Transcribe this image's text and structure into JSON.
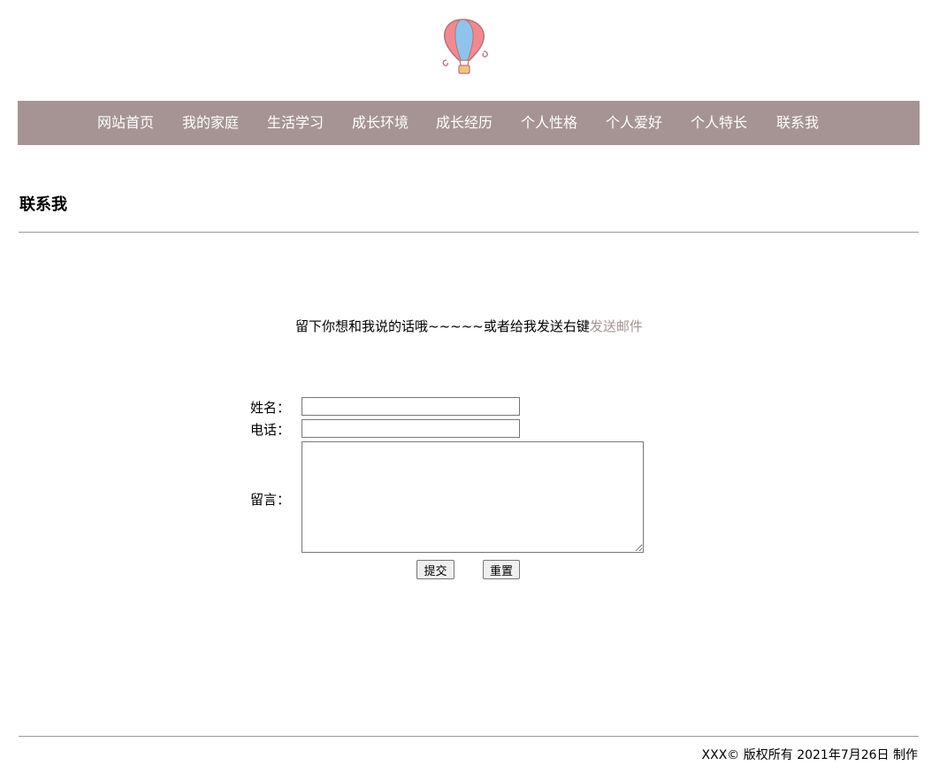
{
  "logo": {
    "icon": "hot-air-balloon-icon"
  },
  "nav": {
    "items": [
      "网站首页",
      "我的家庭",
      "生活学习",
      "成长环境",
      "成长经历",
      "个人性格",
      "个人爱好",
      "个人特长",
      "联系我"
    ],
    "background": "#a69494"
  },
  "page": {
    "title": "联系我"
  },
  "intro": {
    "text": "留下你想和我说的话哦~~~~~或者给我发送右键",
    "link_text": "发送邮件",
    "link_color": "#a69494"
  },
  "form": {
    "name_label": "姓名：",
    "phone_label": "电话：",
    "message_label": "留言：",
    "name_value": "",
    "phone_value": "",
    "message_value": "",
    "submit_label": "提交",
    "reset_label": "重置"
  },
  "footer": {
    "text": "XXX© 版权所有 2021年7月26日 制作"
  }
}
